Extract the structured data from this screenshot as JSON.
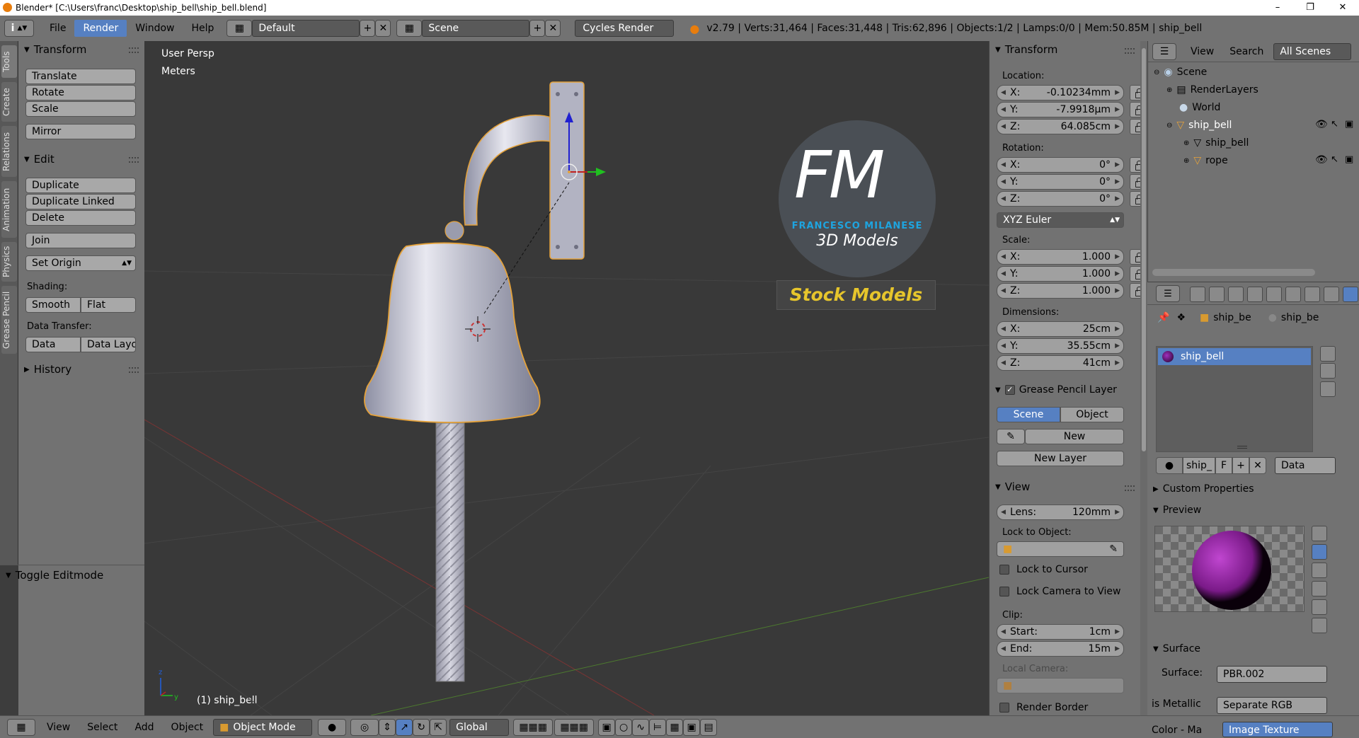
{
  "title": "Blender* [C:\\Users\\franc\\Desktop\\ship_bell\\ship_bell.blend]",
  "menus": [
    "File",
    "Render",
    "Window",
    "Help"
  ],
  "layout_name": "Default",
  "scene_name": "Scene",
  "engine": "Cycles Render",
  "stats": "v2.79 | Verts:31,464 | Faces:31,448 | Tris:62,896 | Objects:1/2 | Lamps:0/0 | Mem:50.85M | ship_bell",
  "left_tabs": [
    "Tools",
    "Create",
    "Relations",
    "Animation",
    "Physics",
    "Grease Pencil"
  ],
  "toolshelf": {
    "transform_header": "Transform",
    "translate": "Translate",
    "rotate": "Rotate",
    "scale": "Scale",
    "mirror": "Mirror",
    "edit_header": "Edit",
    "duplicate": "Duplicate",
    "duplicate_linked": "Duplicate Linked",
    "delete": "Delete",
    "join": "Join",
    "set_origin": "Set Origin",
    "shading_label": "Shading:",
    "smooth": "Smooth",
    "flat": "Flat",
    "data_transfer_label": "Data Transfer:",
    "data": "Data",
    "data_layout": "Data Layo",
    "history": "History",
    "toggle_editmode": "Toggle Editmode"
  },
  "viewport": {
    "view_name": "User Persp",
    "units": "Meters",
    "selected": "(1) ship_bell",
    "logo_letters": "FM",
    "logo_name": "FRANCESCO MILANESE",
    "logo_sub": "3D Models",
    "stock": "Stock Models"
  },
  "npanel": {
    "transform_header": "Transform",
    "location_label": "Location:",
    "loc_x": "-0.10234mm",
    "loc_y": "-7.9918µm",
    "loc_z": "64.085cm",
    "rotation_label": "Rotation:",
    "rot_x": "0°",
    "rot_y": "0°",
    "rot_z": "0°",
    "rotation_mode": "XYZ Euler",
    "scale_label": "Scale:",
    "scale_x": "1.000",
    "scale_y": "1.000",
    "scale_z": "1.000",
    "dimensions_label": "Dimensions:",
    "dim_x": "25cm",
    "dim_y": "35.55cm",
    "dim_z": "41cm",
    "gp_header": "Grease Pencil Layer",
    "gp_scene": "Scene",
    "gp_object": "Object",
    "gp_new": "New",
    "gp_new_layer": "New Layer",
    "view_header": "View",
    "lens_key": "Lens:",
    "lens_value": "120mm",
    "lock_object_label": "Lock to Object:",
    "lock_cursor": "Lock to Cursor",
    "lock_camera": "Lock Camera to View",
    "clip_label": "Clip:",
    "clip_start_key": "Start:",
    "clip_start": "1cm",
    "clip_end_key": "End:",
    "clip_end": "15m",
    "local_camera_label": "Local Camera:",
    "render_border": "Render Border"
  },
  "outliner": {
    "view": "View",
    "search": "Search",
    "filter": "All Scenes",
    "rows": [
      "Scene",
      "RenderLayers",
      "World",
      "ship_bell",
      "ship_bell",
      "rope"
    ]
  },
  "properties": {
    "crumb1": "ship_be",
    "crumb2": "ship_be",
    "material_slot": "ship_bell",
    "mat_name": "ship_",
    "mat_f": "F",
    "data_dropdown": "Data",
    "custom_props": "Custom Properties",
    "preview": "Preview",
    "surface_header": "Surface",
    "surface_key": "Surface:",
    "surface_value": "PBR.002",
    "metallic_key": "is Metallic",
    "metallic_value": "Separate RGB",
    "color_key": "Color - Ma",
    "color_value": "Image Texture"
  },
  "footer": {
    "view": "View",
    "select": "Select",
    "add": "Add",
    "object": "Object",
    "mode": "Object Mode",
    "orientation": "Global"
  },
  "colors": {
    "accent": "#5680c2",
    "panel": "#727272",
    "viewport": "#393939",
    "selection_outline": "#e5a23a",
    "stock_text": "#e6c52c",
    "logo_blue": "#1ea4df"
  }
}
